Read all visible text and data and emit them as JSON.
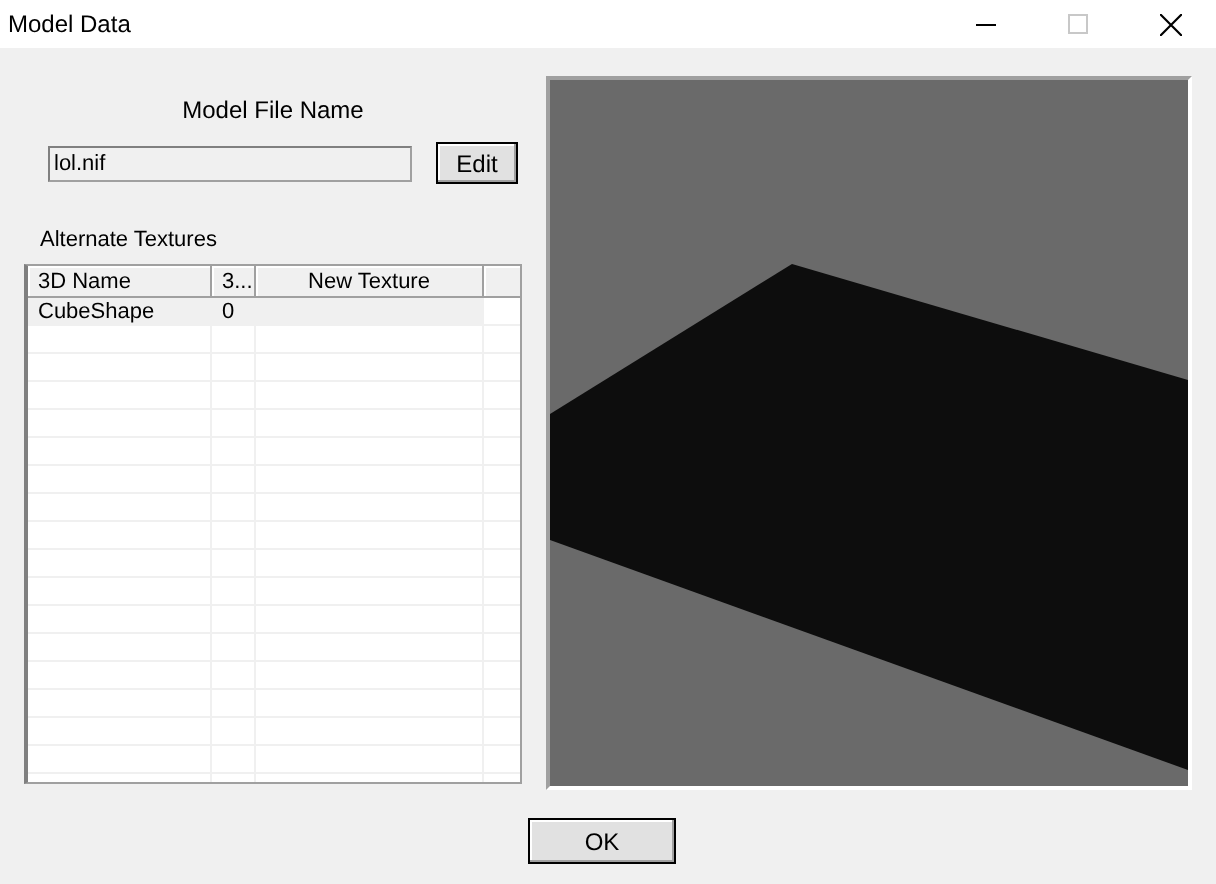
{
  "window": {
    "title": "Model Data",
    "maximize_disabled": true
  },
  "model_file": {
    "label": "Model File Name",
    "value": "lol.nif",
    "edit_button": "Edit"
  },
  "textures": {
    "label": "Alternate Textures",
    "columns": [
      "3D Name",
      "3...",
      "New Texture"
    ],
    "rows": [
      {
        "name": "CubeShape",
        "column_2": "0",
        "new_texture": "",
        "selected": true
      }
    ]
  },
  "ok_button": "OK"
}
